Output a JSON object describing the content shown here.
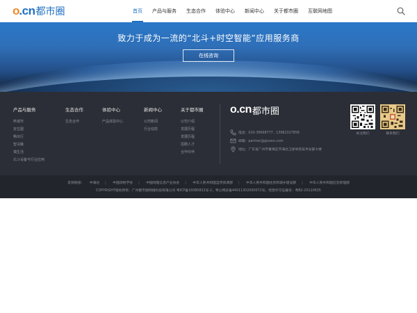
{
  "header": {
    "logo_o": "o",
    "logo_cn": ".cn",
    "logo_text": "都市圈",
    "nav": [
      {
        "label": "首页",
        "active": true
      },
      {
        "label": "产品与服务",
        "active": false
      },
      {
        "label": "生态合作",
        "active": false
      },
      {
        "label": "体验中心",
        "active": false
      },
      {
        "label": "新闻中心",
        "active": false
      },
      {
        "label": "关于都市圈",
        "active": false
      },
      {
        "label": "互联网地图",
        "active": false
      }
    ],
    "search_icon": "search-icon"
  },
  "banner": {
    "title": "致力于成为一流的“北斗+时空智能”应用服务商",
    "button_label": "在线咨询"
  },
  "footer": {
    "columns": [
      {
        "title": "产品与服务",
        "links": [
          "咚城市",
          "定位图",
          "畅出行",
          "智决策",
          "慎生活",
          "北斗设备与行业应用"
        ]
      },
      {
        "title": "生态合作",
        "links": [
          "生态合作"
        ]
      },
      {
        "title": "体验中心",
        "links": [
          "产品体验中心"
        ]
      },
      {
        "title": "新闻中心",
        "links": [
          "公司新闻",
          "行业动态"
        ]
      },
      {
        "title": "关于都市圈",
        "links": [
          "公司介绍",
          "发展历程",
          "发展历程",
          "招聘人才",
          "合作伙伴"
        ]
      }
    ],
    "logo_oc": "o.cn",
    "logo_text": "都市圈",
    "contact": {
      "phone": "电话：020-36698777 , 13982327858",
      "email": "邮箱：partner@gisoon.com",
      "address": "地址：广东省广州市番禺区市海达卫星导航技术总部大楼"
    },
    "qr": [
      {
        "label": "关注我们"
      },
      {
        "label": "联系我们"
      }
    ]
  },
  "bottom": {
    "friend_label": "友情链接：",
    "friend_links": [
      "中海达",
      "中国测绘学会",
      "中国地理信息产业协会",
      "中华人民共和国自然资源部",
      "中华人民共和国住房和城乡建设部",
      "中华人民共和国应急管理部"
    ],
    "copyright": "COPYRIGHT版权所有：广州都市圈网络科技有限公司    粤ICP备16080832号-2，粤公网安备44011302000072号，经营许可证编号：粤B2-20120635"
  },
  "colors": {
    "brand_blue": "#1f6fc2",
    "brand_orange": "#f08a24",
    "footer_bg": "#2b2e36",
    "bottom_bg": "#22252c"
  }
}
